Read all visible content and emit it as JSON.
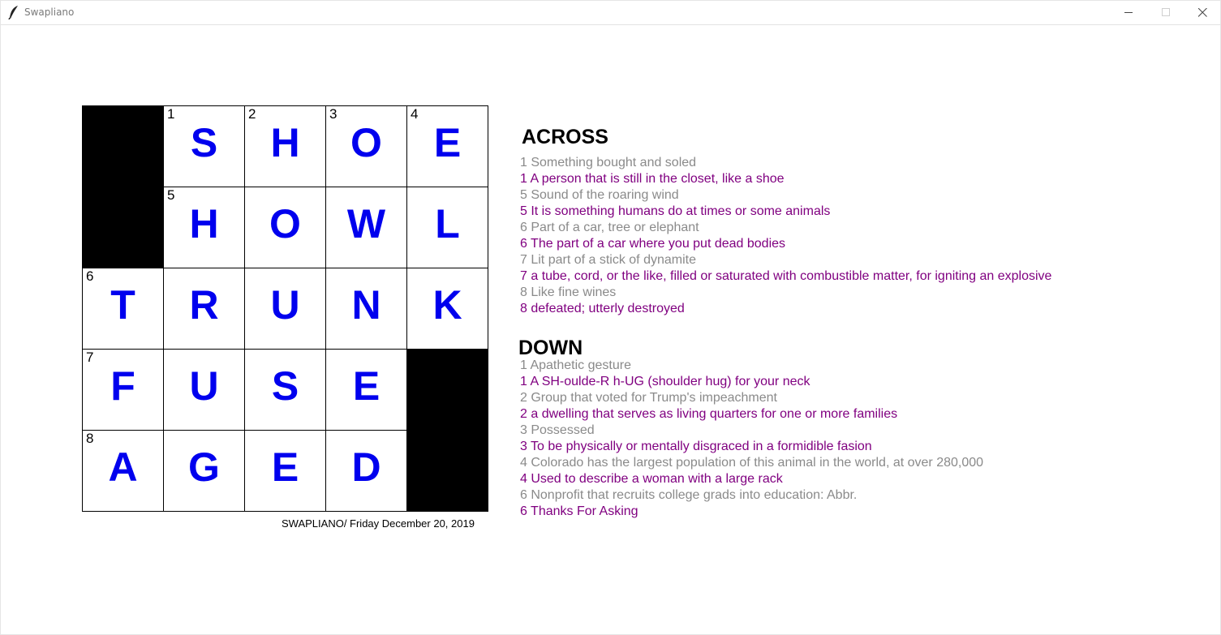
{
  "window": {
    "title": "Swapliano"
  },
  "grid": {
    "rows": [
      [
        {
          "black": true,
          "num": "",
          "letter": ""
        },
        {
          "black": false,
          "num": "1",
          "letter": "S"
        },
        {
          "black": false,
          "num": "2",
          "letter": "H"
        },
        {
          "black": false,
          "num": "3",
          "letter": "O"
        },
        {
          "black": false,
          "num": "4",
          "letter": "E"
        }
      ],
      [
        {
          "black": true,
          "num": "",
          "letter": ""
        },
        {
          "black": false,
          "num": "5",
          "letter": "H"
        },
        {
          "black": false,
          "num": "",
          "letter": "O"
        },
        {
          "black": false,
          "num": "",
          "letter": "W"
        },
        {
          "black": false,
          "num": "",
          "letter": "L"
        }
      ],
      [
        {
          "black": false,
          "num": "6",
          "letter": "T"
        },
        {
          "black": false,
          "num": "",
          "letter": "R"
        },
        {
          "black": false,
          "num": "",
          "letter": "U"
        },
        {
          "black": false,
          "num": "",
          "letter": "N"
        },
        {
          "black": false,
          "num": "",
          "letter": "K"
        }
      ],
      [
        {
          "black": false,
          "num": "7",
          "letter": "F"
        },
        {
          "black": false,
          "num": "",
          "letter": "U"
        },
        {
          "black": false,
          "num": "",
          "letter": "S"
        },
        {
          "black": false,
          "num": "",
          "letter": "E"
        },
        {
          "black": true,
          "num": "",
          "letter": ""
        }
      ],
      [
        {
          "black": false,
          "num": "8",
          "letter": "A"
        },
        {
          "black": false,
          "num": "",
          "letter": "G"
        },
        {
          "black": false,
          "num": "",
          "letter": "E"
        },
        {
          "black": false,
          "num": "",
          "letter": "D"
        },
        {
          "black": true,
          "num": "",
          "letter": ""
        }
      ]
    ]
  },
  "byline": "SWAPLIANO/ Friday December 20, 2019",
  "across": {
    "heading": "ACROSS",
    "clues": [
      {
        "text": "1 Something bought and soled",
        "style": "original"
      },
      {
        "text": "1 A person that is still in the closet, like a shoe",
        "style": "generated"
      },
      {
        "text": "5 Sound of the roaring wind",
        "style": "original"
      },
      {
        "text": "5 It is something humans do at times or some animals",
        "style": "generated"
      },
      {
        "text": "6 Part of a car, tree or elephant",
        "style": "original"
      },
      {
        "text": "6 The part of a car where you put dead bodies",
        "style": "generated"
      },
      {
        "text": "7 Lit part of a stick of dynamite",
        "style": "original"
      },
      {
        "text": "7 a tube, cord, or the like, filled or saturated with combustible matter, for igniting an explosive",
        "style": "generated"
      },
      {
        "text": "8 Like fine wines",
        "style": "original"
      },
      {
        "text": "8 defeated; utterly destroyed",
        "style": "generated"
      }
    ]
  },
  "down": {
    "heading": "DOWN",
    "clues": [
      {
        "text": "1 Apathetic gesture",
        "style": "original"
      },
      {
        "text": "1 A SH-oulde-R h-UG (shoulder hug) for your neck",
        "style": "generated"
      },
      {
        "text": "2 Group that voted for Trump's impeachment",
        "style": "original"
      },
      {
        "text": "2 a dwelling that serves as living quarters for one or more families",
        "style": "generated"
      },
      {
        "text": "3 Possessed",
        "style": "original"
      },
      {
        "text": "3 To be physically or mentally disgraced in a formidible fasion",
        "style": "generated"
      },
      {
        "text": "4 Colorado has the largest population of this animal in the world, at over 280,000",
        "style": "original"
      },
      {
        "text": "4 Used to describe a woman with a large rack",
        "style": "generated"
      },
      {
        "text": "6 Nonprofit that recruits college grads into education: Abbr.",
        "style": "original"
      },
      {
        "text": "6 Thanks For Asking",
        "style": "generated"
      }
    ]
  },
  "colors": {
    "letter": "#0000ee",
    "original_clue": "#8a8a8a",
    "generated_clue": "#800080",
    "black_cell": "#000000"
  },
  "icons": {
    "app": "feather-icon",
    "minimize": "minimize-icon",
    "maximize": "maximize-icon",
    "close": "close-icon"
  }
}
